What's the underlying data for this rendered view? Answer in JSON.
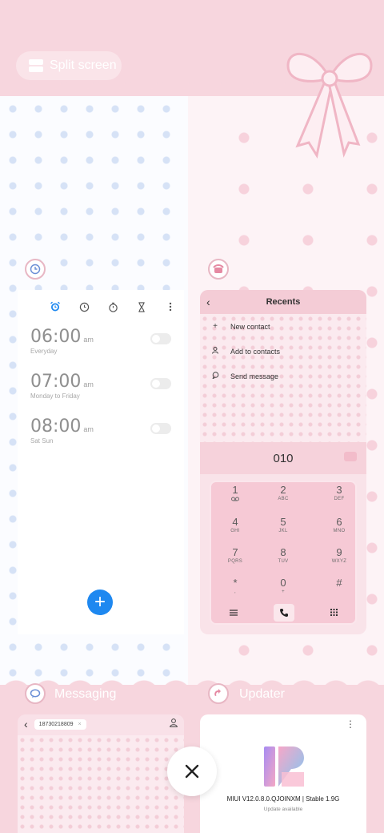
{
  "split_screen": {
    "label": "Split screen"
  },
  "clock": {
    "alarms": [
      {
        "time": "06:00",
        "ampm": "am",
        "repeat": "Everyday",
        "enabled": false
      },
      {
        "time": "07:00",
        "ampm": "am",
        "repeat": "Monday to Friday",
        "enabled": false
      },
      {
        "time": "08:00",
        "ampm": "am",
        "repeat": "Sat Sun",
        "enabled": false
      }
    ],
    "toolbar_icons": [
      "alarm-icon",
      "clock-icon",
      "stopwatch-icon",
      "timer-icon",
      "more-icon"
    ],
    "fab_label": "+",
    "accent": "#1e88f0"
  },
  "dialer": {
    "title": "Recents",
    "menu": [
      {
        "icon": "plus-icon",
        "label": "New contact"
      },
      {
        "icon": "person-icon",
        "label": "Add to contacts"
      },
      {
        "icon": "chat-bubble-icon",
        "label": "Send message"
      }
    ],
    "number": "010",
    "keys": [
      {
        "digit": "1",
        "letters": ""
      },
      {
        "digit": "2",
        "letters": "ABC"
      },
      {
        "digit": "3",
        "letters": "DEF"
      },
      {
        "digit": "4",
        "letters": "GHI"
      },
      {
        "digit": "5",
        "letters": "JKL"
      },
      {
        "digit": "6",
        "letters": "MNO"
      },
      {
        "digit": "7",
        "letters": "PQRS"
      },
      {
        "digit": "8",
        "letters": "TUV"
      },
      {
        "digit": "9",
        "letters": "WXYZ"
      },
      {
        "digit": "*",
        "letters": ","
      },
      {
        "digit": "0",
        "letters": "+"
      },
      {
        "digit": "#",
        "letters": ""
      }
    ]
  },
  "messaging": {
    "app_name": "Messaging",
    "contact": "18730218809",
    "chip_close": "×"
  },
  "updater": {
    "app_name": "Updater",
    "version": "MIUI V12.0.8.0.QJOINXM | Stable 1.9G",
    "status": "Update available"
  },
  "close_button": {
    "icon": "close-icon"
  }
}
